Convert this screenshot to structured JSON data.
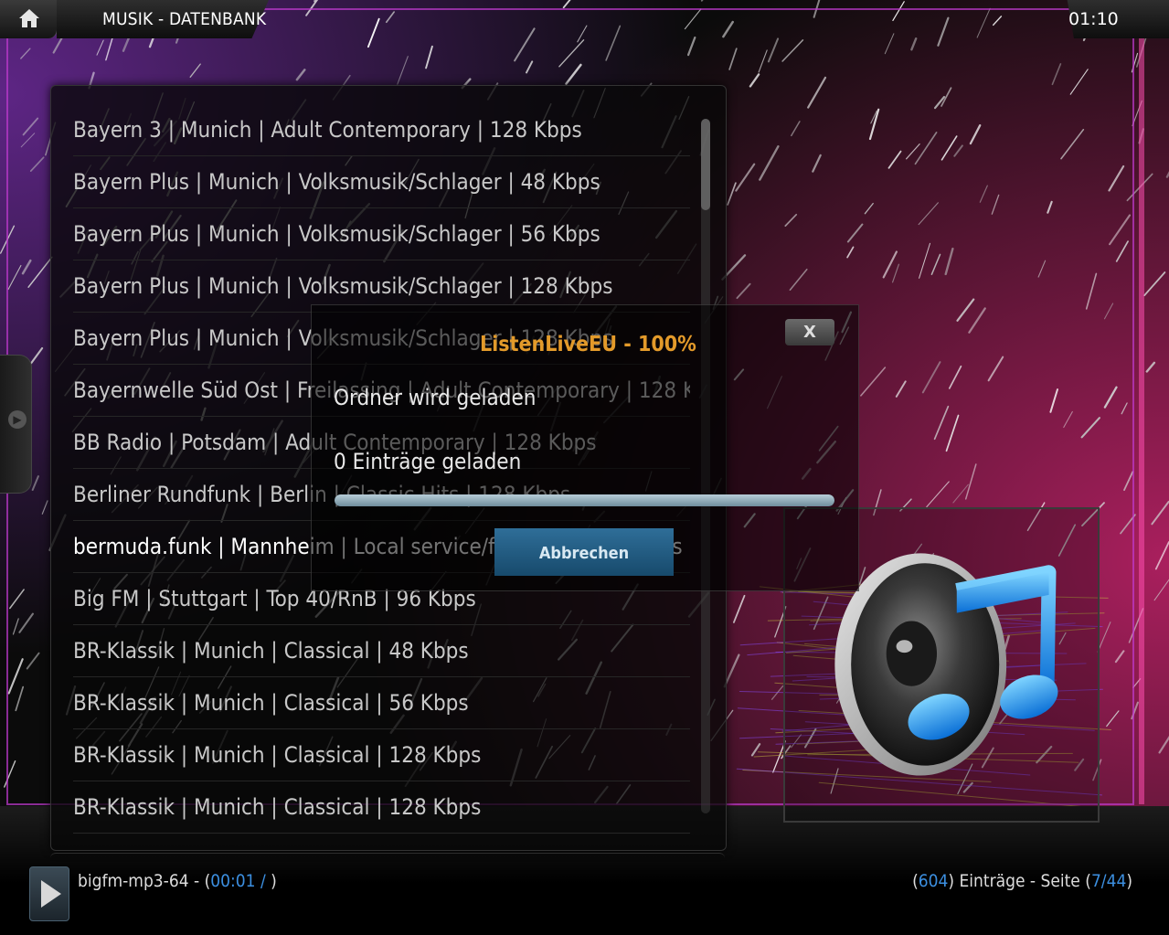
{
  "header": {
    "title": "MUSIK - DATENBANK",
    "clock": "01:10"
  },
  "list": {
    "items": [
      {
        "label": "Bayern 3 | Munich | Adult Contemporary | 128 Kbps"
      },
      {
        "label": "Bayern Plus | Munich | Volksmusik/Schlager | 48 Kbps"
      },
      {
        "label": "Bayern Plus | Munich | Volksmusik/Schlager | 56 Kbps"
      },
      {
        "label": "Bayern Plus | Munich | Volksmusik/Schlager | 128 Kbps"
      },
      {
        "label": "Bayern Plus | Munich | Volksmusik/Schlager | 128 Kbps"
      },
      {
        "label": "Bayernwelle Süd Ost | Freilassing | Adult Contemporary | 128 K..."
      },
      {
        "label": "BB Radio | Potsdam | Adult Contemporary | 128 Kbps"
      },
      {
        "label": "Berliner Rundfunk | Berlin | Classic Hits | 128 Kbps"
      },
      {
        "label": "bermuda.funk | Mannheim | Local service/free radio | 80 Kbps"
      },
      {
        "label": "Big FM | Stuttgart | Top 40/RnB | 96 Kbps"
      },
      {
        "label": "BR-Klassik | Munich | Classical | 48 Kbps"
      },
      {
        "label": "BR-Klassik | Munich | Classical | 56 Kbps"
      },
      {
        "label": "BR-Klassik | Munich | Classical | 128 Kbps"
      },
      {
        "label": "BR-Klassik | Munich | Classical | 128 Kbps"
      }
    ],
    "active_index": 8
  },
  "dialog": {
    "title": "ListenLiveEU - 100%",
    "close_label": "X",
    "line1": "Ordner wird geladen",
    "line2": "0 Einträge geladen",
    "progress": 1.0,
    "button_label": "Abbrechen"
  },
  "footer": {
    "track": "bigfm-mp3-64 - (",
    "time": "00:01 /",
    "track_close": " )",
    "count_open": "(",
    "count": "604",
    "count_text": ") Einträge - Seite (",
    "page": "7/44",
    "page_close": ")"
  },
  "icons": {
    "home": "home-icon",
    "play": "play-icon",
    "music": "music-note-speaker-icon"
  },
  "colors": {
    "accent_blue": "#3c8fe0",
    "dialog_title": "#e39a2a",
    "button": "#1f5b84"
  }
}
